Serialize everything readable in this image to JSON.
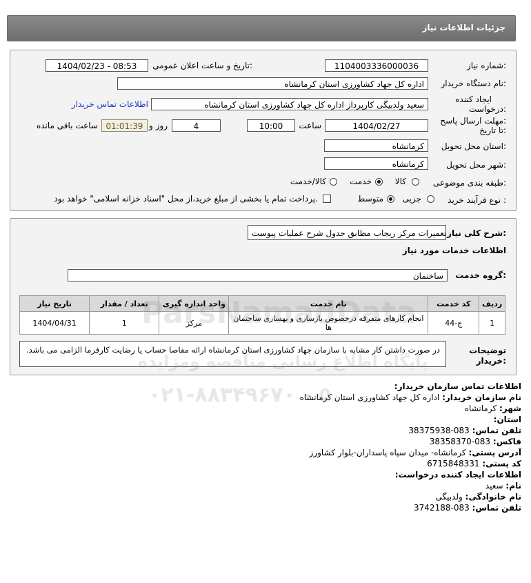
{
  "header": {
    "title": "جزئیات اطلاعات نیاز"
  },
  "form": {
    "need_number_label": "شماره نیاز:",
    "need_number": "1104003336000036",
    "announce_label": "تاریخ و ساعت اعلان عمومی:",
    "announce_value": "1404/02/23 - 08:53",
    "buyer_org_label": "نام دستگاه خریدار:",
    "buyer_org": "اداره کل جهاد کشاورزی استان کرمانشاه",
    "creator_label_1": "ایجاد کننده",
    "creator_label_2": "درخواست:",
    "creator": "سعید ولدبیگی کارپرداز اداره کل جهاد کشاورزی استان کرمانشاه",
    "contact_link": "اطلاعات تماس خریدار",
    "deadline_label_1": "مهلت ارسال پاسخ:",
    "deadline_label_2": "تا تاریخ:",
    "deadline_date": "1404/02/27",
    "time_label": "ساعت",
    "deadline_time": "10:00",
    "days_value": "4",
    "days_label": "روز و",
    "remaining_timer": "01:01:39",
    "remaining_label": "ساعت باقی مانده",
    "province_label": "استان محل تحویل:",
    "province": "کرمانشاه",
    "city_label": "شهر محل تحویل:",
    "city": "کرمانشاه",
    "category_label": "طبقه بندی موضوعی:",
    "category_options": [
      "کالا",
      "خدمت",
      "کالا/خدمت"
    ],
    "category_selected": "خدمت",
    "process_label": "نوع فرآیند خرید :",
    "process_options": [
      "جزیی",
      "متوسط"
    ],
    "process_selected": "متوسط",
    "payment_note": "پرداخت تمام یا بخشی از مبلغ خرید،از محل \"اسناد خزانه اسلامی\" خواهد بود."
  },
  "details": {
    "summary_label": "شرح کلی نیاز:",
    "summary": "تعمیرات مرکز ریجاب مطابق جدول شرح عملیات پیوست",
    "services_heading": "اطلاعات خدمات مورد نیاز",
    "service_group_label": "گروه خدمت:",
    "service_group": "ساختمان",
    "table": {
      "headers": [
        "ردیف",
        "کد خدمت",
        "نام خدمت",
        "واحد اندازه گیری",
        "تعداد / مقدار",
        "تاریخ نیاز"
      ],
      "rows": [
        [
          "1",
          "ج-44",
          "انجام کارهای متفرقه درخصوص بازسازی و بهسازی ساختمان ها",
          "مرکز",
          "1",
          "1404/04/31"
        ]
      ]
    },
    "buyer_notes_label_1": "توضیحات",
    "buyer_notes_label_2": "خریدار:",
    "buyer_notes": "در صورت داشتن کار مشابه با سازمان جهاد کشاورزی استان کرمانشاه ارائه مفاصا حساب یا رضایت کارفرما الزامی می باشد."
  },
  "contact": {
    "heading": "اطلاعات تماس سازمان خریدار:",
    "org_label": "نام سازمان خریدار:",
    "org": "اداره کل جهاد کشاورزی استان کرمانشاه",
    "city_label": "شهر:",
    "city": "کرمانشاه",
    "province_label": "استان:",
    "province": "کرمانشاه",
    "phone_label": "تلفن تماس:",
    "phone": "083-38375938",
    "fax_label": "فاکس:",
    "fax": "083-38358370",
    "address_label": "آدرس پستی:",
    "address": "کرمانشاه- میدان سپاه پاسداران-بلوار کشاورز",
    "postal_label": "کد پستی:",
    "postal": "6715848331",
    "creator_heading": "اطلاعات ایجاد کننده درخواست:",
    "name_label": "نام:",
    "name": "سعید",
    "family_label": "نام خانوادگی:",
    "family": "ولدبیگی",
    "creator_phone_label": "تلفن تماس:",
    "creator_phone": "083-3742188"
  },
  "watermark": {
    "brand": "ParsNamadData",
    "line1": "پایگاه اطلاع رسانی مناقصه ومزایده",
    "phone": "۰۲۱-۸۸۳۴۹۶۷۰ - ۵"
  }
}
